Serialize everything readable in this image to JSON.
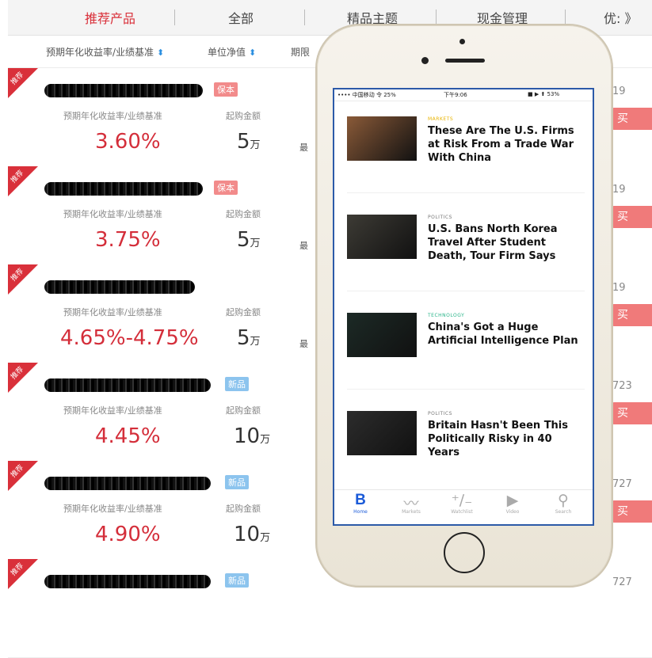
{
  "tabs": [
    "推荐产品",
    "全部",
    "精品主题",
    "现金管理",
    "优:"
  ],
  "tab_more": "》",
  "sort": {
    "yield_label": "预期年化收益率/业绩基准",
    "nav_label": "单位净值",
    "term_label": "期限",
    "arrow": "⬍"
  },
  "products": [
    {
      "ribbon": "推荐",
      "badge": "保本",
      "badge_color": "red",
      "yield_label": "预期年化收益率/业绩基准",
      "rate": "3.60%",
      "amount_label": "起购金额",
      "amount": "5",
      "unit": "万",
      "trunc": "最",
      "right_num": "19",
      "buy": "买"
    },
    {
      "ribbon": "推荐",
      "badge": "保本",
      "badge_color": "red",
      "yield_label": "预期年化收益率/业绩基准",
      "rate": "3.75%",
      "amount_label": "起购金额",
      "amount": "5",
      "unit": "万",
      "trunc": "最",
      "right_num": "19",
      "buy": "买"
    },
    {
      "ribbon": "推荐",
      "badge": "",
      "badge_color": "",
      "yield_label": "预期年化收益率/业绩基准",
      "rate": "4.65%-4.75%",
      "amount_label": "起购金额",
      "amount": "5",
      "unit": "万",
      "trunc": "最",
      "right_num": "19",
      "buy": "买"
    },
    {
      "ribbon": "推荐",
      "badge": "新品",
      "badge_color": "blue",
      "yield_label": "预期年化收益率/业绩基准",
      "rate": "4.45%",
      "amount_label": "起购金额",
      "amount": "10",
      "unit": "万",
      "trunc": "",
      "right_num": "723",
      "buy": "买"
    },
    {
      "ribbon": "推荐",
      "badge": "新品",
      "badge_color": "blue",
      "yield_label": "预期年化收益率/业绩基准",
      "rate": "4.90%",
      "amount_label": "起购金额",
      "amount": "10",
      "unit": "万",
      "trunc": "",
      "right_num": "727",
      "buy": "买"
    },
    {
      "ribbon": "推荐",
      "badge": "新品",
      "badge_color": "blue",
      "yield_label": "",
      "rate": "",
      "amount_label": "",
      "amount": "",
      "unit": "",
      "trunc": "",
      "right_num": "727",
      "buy": ""
    }
  ],
  "phone": {
    "status": {
      "left": "•••• 中国移动 令 25%",
      "time": "下午9:06",
      "right": "■ ▶ ⬆ 53%"
    },
    "articles": [
      {
        "category": "MARKETS",
        "category_color": "#e8b300",
        "headline": "These Are The U.S. Firms at Risk From a Trade War With China",
        "thumb_color": "#8a5a38"
      },
      {
        "category": "POLITICS",
        "category_color": "#777777",
        "headline": "U.S. Bans North Korea Travel After Student Death, Tour Firm Says",
        "thumb_color": "#3d3b35"
      },
      {
        "category": "TECHNOLOGY",
        "category_color": "#2ab58a",
        "headline": "China's Got a Huge Artificial Intelligence Plan",
        "thumb_color": "#1c2a26"
      },
      {
        "category": "POLITICS",
        "category_color": "#777777",
        "headline": "Britain Hasn't Been This Politically Risky in 40 Years",
        "thumb_color": "#2c2c2c"
      }
    ],
    "nav": [
      {
        "icon": "B",
        "label": "Home",
        "active": true
      },
      {
        "icon": "〰",
        "label": "Markets",
        "active": false
      },
      {
        "icon": "⁺∕₋",
        "label": "Watchlist",
        "active": false
      },
      {
        "icon": "▶",
        "label": "Video",
        "active": false
      },
      {
        "icon": "⚲",
        "label": "Search",
        "active": false
      }
    ]
  }
}
